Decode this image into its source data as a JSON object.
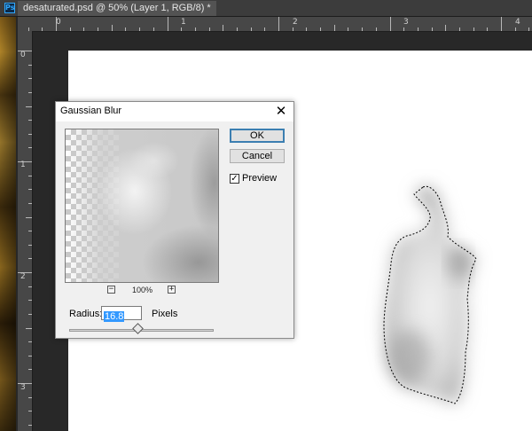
{
  "app": {
    "logo_text": "Ps",
    "document_tab": "desaturated.psd @ 50% (Layer 1, RGB/8) *"
  },
  "ruler": {
    "top_numbers": [
      "0",
      "1",
      "2",
      "3",
      "4"
    ],
    "left_numbers": [
      "0",
      "1",
      "2",
      "3"
    ]
  },
  "dialog": {
    "title": "Gaussian Blur",
    "close_glyph": "✕",
    "ok_label": "OK",
    "cancel_label": "Cancel",
    "preview_label": "Preview",
    "preview_checked": true,
    "check_glyph": "✓",
    "zoom_out_glyph": "−",
    "zoom_in_glyph": "+",
    "zoom_level": "100%",
    "radius_label": "Radius:",
    "radius_value": "16.8",
    "units_label": "Pixels",
    "slider_fraction": 0.47
  },
  "colors": {
    "workspace": "#282828",
    "canvas": "#ffffff",
    "selection_highlight": "#3399ff",
    "default_button_border": "#3c7fb1"
  }
}
